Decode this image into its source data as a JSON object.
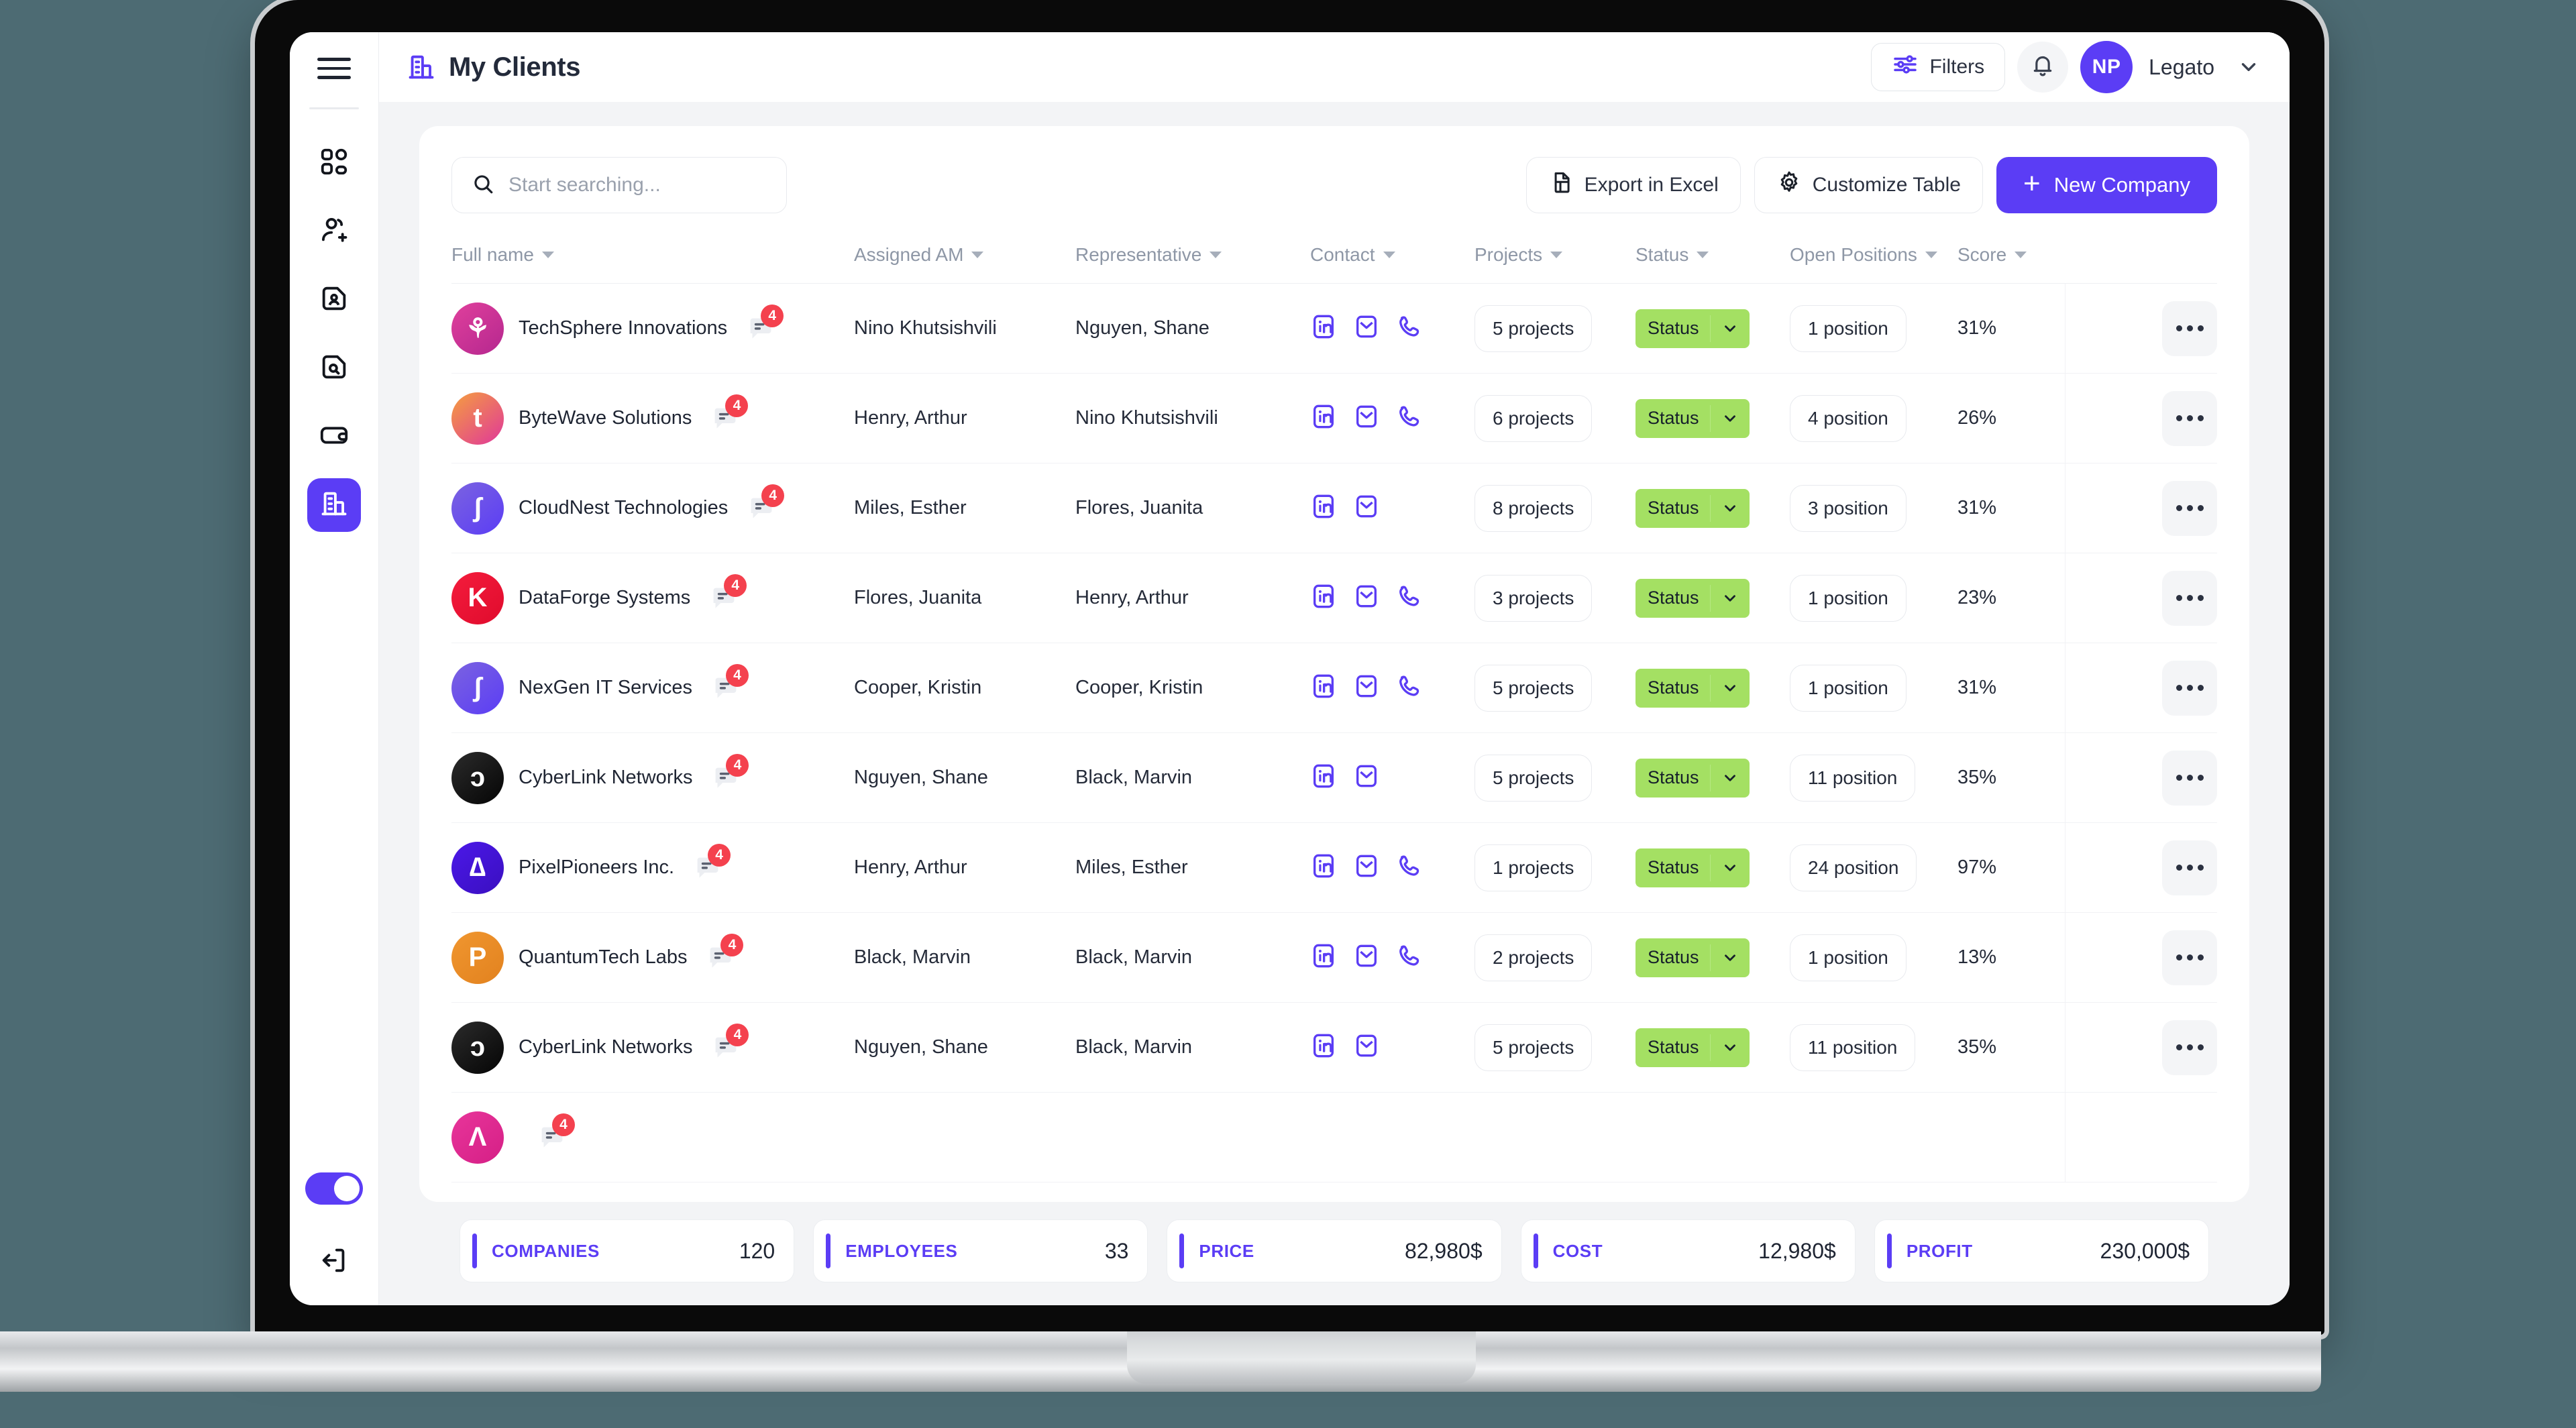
{
  "header": {
    "title": "My Clients",
    "title_icon": "building-icon",
    "filters_label": "Filters",
    "notification_icon": "bell-icon",
    "avatar_initials": "NP",
    "user_name": "Legato"
  },
  "sidebar": {
    "menu_icon": "hamburger-icon",
    "items": [
      {
        "name": "dashboard",
        "icon": "grid-icon",
        "active": false
      },
      {
        "name": "add-user",
        "icon": "user-plus-icon",
        "active": false
      },
      {
        "name": "candidate-profile",
        "icon": "file-user-icon",
        "active": false
      },
      {
        "name": "search-documents",
        "icon": "file-search-icon",
        "active": false
      },
      {
        "name": "wallet",
        "icon": "wallet-icon",
        "active": false
      },
      {
        "name": "clients",
        "icon": "building-icon",
        "active": true
      }
    ],
    "theme_toggle": {
      "icon": "toggle-on-icon",
      "on": true
    },
    "logout_icon": "logout-icon"
  },
  "toolbar": {
    "search_placeholder": "Start searching...",
    "search_value": "",
    "search_icon": "search-icon",
    "export_label": "Export in Excel",
    "export_icon": "file-export-icon",
    "customize_label": "Customize Table",
    "customize_icon": "gear-icon",
    "new_company_label": "New Company",
    "new_company_icon": "plus-icon"
  },
  "table": {
    "columns": [
      {
        "key": "full_name",
        "label": "Full name",
        "sortable": true
      },
      {
        "key": "assigned_am",
        "label": "Assigned AM",
        "sortable": true
      },
      {
        "key": "representative",
        "label": "Representative",
        "sortable": true
      },
      {
        "key": "contact",
        "label": "Contact",
        "sortable": true
      },
      {
        "key": "projects",
        "label": "Projects",
        "sortable": true
      },
      {
        "key": "status",
        "label": "Status",
        "sortable": true
      },
      {
        "key": "open_positions",
        "label": "Open Positions",
        "sortable": true
      },
      {
        "key": "score",
        "label": "Score",
        "sortable": true
      },
      {
        "key": "actions",
        "label": "",
        "sortable": false
      }
    ],
    "status_label": "Status",
    "row_actions_icon": "more-horizontal-icon",
    "rows": [
      {
        "full_name": "TechSphere Innovations",
        "logo_text": "⚘",
        "logo_from": "#e0409c",
        "logo_to": "#b5278f",
        "notes_count": "4",
        "assigned_am": "Nino Khutsishvili",
        "representative": "Nguyen, Shane",
        "contact": [
          "linkedin-icon",
          "email-icon",
          "phone-icon"
        ],
        "projects": "5 projects",
        "status": "Status",
        "open_positions": "1 position",
        "score": "31%"
      },
      {
        "full_name": "ByteWave Solutions",
        "logo_text": "t",
        "logo_from": "#f59f3e",
        "logo_to": "#e0379a",
        "notes_count": "4",
        "assigned_am": "Henry, Arthur",
        "representative": "Nino Khutsishvili",
        "contact": [
          "linkedin-icon",
          "email-icon",
          "phone-icon"
        ],
        "projects": "6 projects",
        "status": "Status",
        "open_positions": "4 position",
        "score": "26%"
      },
      {
        "full_name": "CloudNest Technologies",
        "logo_text": "ʃ",
        "logo_from": "#7b63e0",
        "logo_to": "#5b3df5",
        "notes_count": "4",
        "assigned_am": "Miles, Esther",
        "representative": "Flores, Juanita",
        "contact": [
          "linkedin-icon",
          "email-icon"
        ],
        "projects": "8 projects",
        "status": "Status",
        "open_positions": "3 position",
        "score": "31%"
      },
      {
        "full_name": "DataForge Systems",
        "logo_text": "K",
        "logo_from": "#f41c3c",
        "logo_to": "#e00b2d",
        "notes_count": "4",
        "assigned_am": "Flores, Juanita",
        "representative": "Henry, Arthur",
        "contact": [
          "linkedin-icon",
          "email-icon",
          "phone-icon"
        ],
        "projects": "3 projects",
        "status": "Status",
        "open_positions": "1 position",
        "score": "23%"
      },
      {
        "full_name": "NexGen IT Services",
        "logo_text": "ʃ",
        "logo_from": "#7b63e0",
        "logo_to": "#5b3df5",
        "notes_count": "4",
        "assigned_am": "Cooper, Kristin",
        "representative": "Cooper, Kristin",
        "contact": [
          "linkedin-icon",
          "email-icon",
          "phone-icon"
        ],
        "projects": "5 projects",
        "status": "Status",
        "open_positions": "1 position",
        "score": "31%"
      },
      {
        "full_name": "CyberLink Networks",
        "logo_text": "ɔ",
        "logo_from": "#2b2b2b",
        "logo_to": "#050505",
        "notes_count": "4",
        "assigned_am": "Nguyen, Shane",
        "representative": "Black, Marvin",
        "contact": [
          "linkedin-icon",
          "email-icon"
        ],
        "projects": "5 projects",
        "status": "Status",
        "open_positions": "11 position",
        "score": "35%"
      },
      {
        "full_name": "PixelPioneers Inc.",
        "logo_text": "∆",
        "logo_from": "#4b18e8",
        "logo_to": "#3a0fc0",
        "notes_count": "4",
        "assigned_am": "Henry, Arthur",
        "representative": "Miles, Esther",
        "contact": [
          "linkedin-icon",
          "email-icon",
          "phone-icon"
        ],
        "projects": "1 projects",
        "status": "Status",
        "open_positions": "24 position",
        "score": "97%"
      },
      {
        "full_name": "QuantumTech Labs",
        "logo_text": "P",
        "logo_from": "#f0962f",
        "logo_to": "#e2821f",
        "notes_count": "4",
        "assigned_am": "Black, Marvin",
        "representative": "Black, Marvin",
        "contact": [
          "linkedin-icon",
          "email-icon",
          "phone-icon"
        ],
        "projects": "2 projects",
        "status": "Status",
        "open_positions": "1 position",
        "score": "13%"
      },
      {
        "full_name": "CyberLink Networks",
        "logo_text": "ɔ",
        "logo_from": "#2b2b2b",
        "logo_to": "#050505",
        "notes_count": "4",
        "assigned_am": "Nguyen, Shane",
        "representative": "Black, Marvin",
        "contact": [
          "linkedin-icon",
          "email-icon"
        ],
        "projects": "5 projects",
        "status": "Status",
        "open_positions": "11 position",
        "score": "35%"
      },
      {
        "full_name": "",
        "logo_text": "Ʌ",
        "logo_from": "#e8359a",
        "logo_to": "#d51f86",
        "notes_count": "4",
        "assigned_am": "",
        "representative": "",
        "contact": [],
        "projects": "",
        "status": "",
        "open_positions": "",
        "score": ""
      }
    ]
  },
  "stats": [
    {
      "label": "COMPANIES",
      "value": "120"
    },
    {
      "label": "EMPLOYEES",
      "value": "33"
    },
    {
      "label": "PRICE",
      "value": "82,980$"
    },
    {
      "label": "COST",
      "value": "12,980$"
    },
    {
      "label": "PROFIT",
      "value": "230,000$"
    }
  ],
  "colors": {
    "accent": "#5b3df5",
    "status_green": "#a4e063",
    "badge_red": "#f4414e",
    "page_bg": "#f3f4f6",
    "desktop_bg": "#4d6b73"
  }
}
